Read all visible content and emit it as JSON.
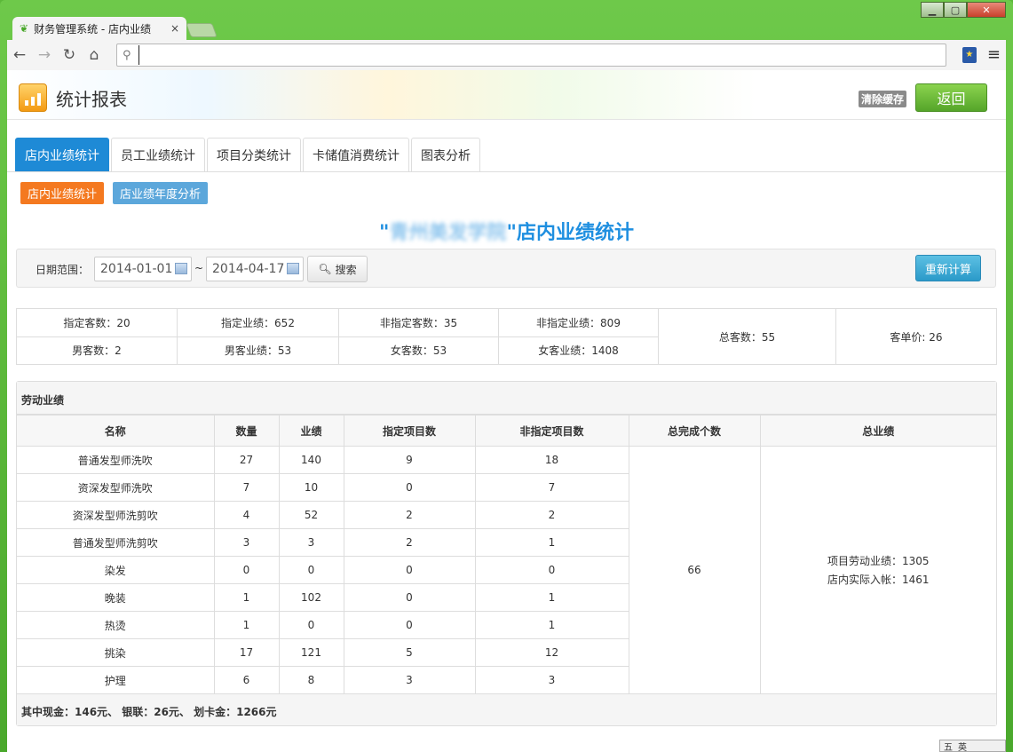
{
  "browser": {
    "tab_title": "财务管理系统 - 店内业绩",
    "tab_close": "×",
    "address_value": ""
  },
  "header": {
    "title": "统计报表",
    "clear_cache": "清除缓存",
    "back": "返回"
  },
  "tabs": [
    "店内业绩统计",
    "员工业绩统计",
    "项目分类统计",
    "卡储值消费统计",
    "图表分析"
  ],
  "subtabs": [
    "店内业绩统计",
    "店业绩年度分析"
  ],
  "report": {
    "quote_open": "\"",
    "store_name": "青州美发学院",
    "quote_close": "\"",
    "suffix": "店内业绩统计"
  },
  "search": {
    "label": "日期范围：",
    "start": "2014-01-01",
    "separator": "~",
    "end": "2014-04-17",
    "button": "搜索",
    "recalc": "重新计算"
  },
  "summary": {
    "r1": [
      "指定客数：20",
      "指定业绩：652",
      "非指定客数：35",
      "非指定业绩：809"
    ],
    "r2": [
      "男客数：2",
      "男客业绩：53",
      "女客数：53",
      "女客业绩：1408"
    ],
    "total_customers": "总客数：55",
    "unit_price": "客单价: 26"
  },
  "labor": {
    "section_title": "劳动业绩",
    "headers": [
      "名称",
      "数量",
      "业绩",
      "指定项目数",
      "非指定项目数",
      "总完成个数",
      "总业绩"
    ],
    "rows": [
      [
        "普通发型师洗吹",
        "27",
        "140",
        "9",
        "18"
      ],
      [
        "资深发型师洗吹",
        "7",
        "10",
        "0",
        "7"
      ],
      [
        "资深发型师洗剪吹",
        "4",
        "52",
        "2",
        "2"
      ],
      [
        "普通发型师洗剪吹",
        "3",
        "3",
        "2",
        "1"
      ],
      [
        "染发",
        "0",
        "0",
        "0",
        "0"
      ],
      [
        "晚装",
        "1",
        "102",
        "0",
        "1"
      ],
      [
        "热烫",
        "1",
        "0",
        "0",
        "1"
      ],
      [
        "挑染",
        "17",
        "121",
        "5",
        "12"
      ],
      [
        "护理",
        "6",
        "8",
        "3",
        "3"
      ]
    ],
    "total_count": "66",
    "total_labor": "项目劳动业绩：1305",
    "total_actual": "店内实际入帐：1461",
    "footer": "其中现金：146元、 银联：26元、 划卡金：1266元"
  },
  "ime": [
    "五",
    "英"
  ]
}
